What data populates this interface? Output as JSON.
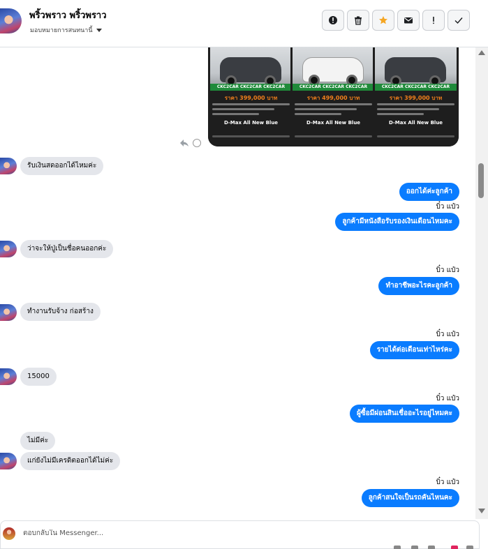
{
  "header": {
    "contact_name": "พริ้วพราว พริ้วพราว",
    "assign_label": "มอบหมายการสนทนานี้",
    "actions": [
      {
        "name": "spam-button",
        "icon": "alert-circle-icon"
      },
      {
        "name": "delete-button",
        "icon": "trash-icon"
      },
      {
        "name": "star-button",
        "icon": "star-icon"
      },
      {
        "name": "mark-unread-button",
        "icon": "envelope-icon"
      },
      {
        "name": "follow-up-button",
        "icon": "exclamation-icon"
      },
      {
        "name": "mark-done-button",
        "icon": "check-icon"
      }
    ],
    "star_color": "#f5a623"
  },
  "attachment": {
    "cards": [
      {
        "band": "CKC2CAR CKC2CAR CKC2CAR",
        "price": "ราคา 399,000 บาท",
        "model": "D-Max All New Blue"
      },
      {
        "band": "CKC2CAR CKC2CAR CKC2CAR",
        "price": "ราคา 499,000 บาท",
        "model": "D-Max All New Blue"
      },
      {
        "band": "CKC2CAR CKC2CAR CKC2CAR",
        "price": "ราคา 399,000 บาท",
        "model": "D-Max All New Blue"
      }
    ]
  },
  "messages": [
    {
      "dir": "in",
      "text": "รับเงินสดออกได้ไหมค่ะ",
      "avatar": true
    },
    {
      "dir": "out",
      "text": "ออกได้ค่ะลูกค้า"
    },
    {
      "dir": "sender",
      "text": "บิ๋ว แป๋ว"
    },
    {
      "dir": "out",
      "text": "ลูกค้ามีหนังสือรับรองเงินเดือนไหมคะ"
    },
    {
      "dir": "in",
      "text": "ว่าจะให้ปู่เป็นชื่อคนออกค่ะ",
      "avatar": true
    },
    {
      "dir": "sender",
      "text": "บิ๋ว แป๋ว"
    },
    {
      "dir": "out",
      "text": "ทำอาชีพอะไรคะลูกค้า"
    },
    {
      "dir": "in",
      "text": "ทำงานรับจ้าง ก่อสร้าง",
      "avatar": true
    },
    {
      "dir": "sender",
      "text": "บิ๋ว แป๋ว"
    },
    {
      "dir": "out",
      "text": "รายได้ต่อเดือนเท่าไหร่คะ"
    },
    {
      "dir": "in",
      "text": "15000",
      "avatar": true
    },
    {
      "dir": "sender",
      "text": "บิ๋ว แป๋ว"
    },
    {
      "dir": "out",
      "text": "ผู้ซื้อมีผ่อนสินเชื่ออะไรอยู่ไหมคะ"
    },
    {
      "dir": "in",
      "text": "ไม่มีค่ะ",
      "avatar": false
    },
    {
      "dir": "in",
      "text": "แก่ยังไม่มีเครดิตออกได้ไม่ค่ะ",
      "avatar": true
    },
    {
      "dir": "sender",
      "text": "บิ๋ว แป๋ว"
    },
    {
      "dir": "out",
      "text": "ลูกค้าสนใจเป็นรถคันไหนคะ"
    }
  ],
  "composer": {
    "placeholder": "ตอบกลับใน Messenger..."
  }
}
